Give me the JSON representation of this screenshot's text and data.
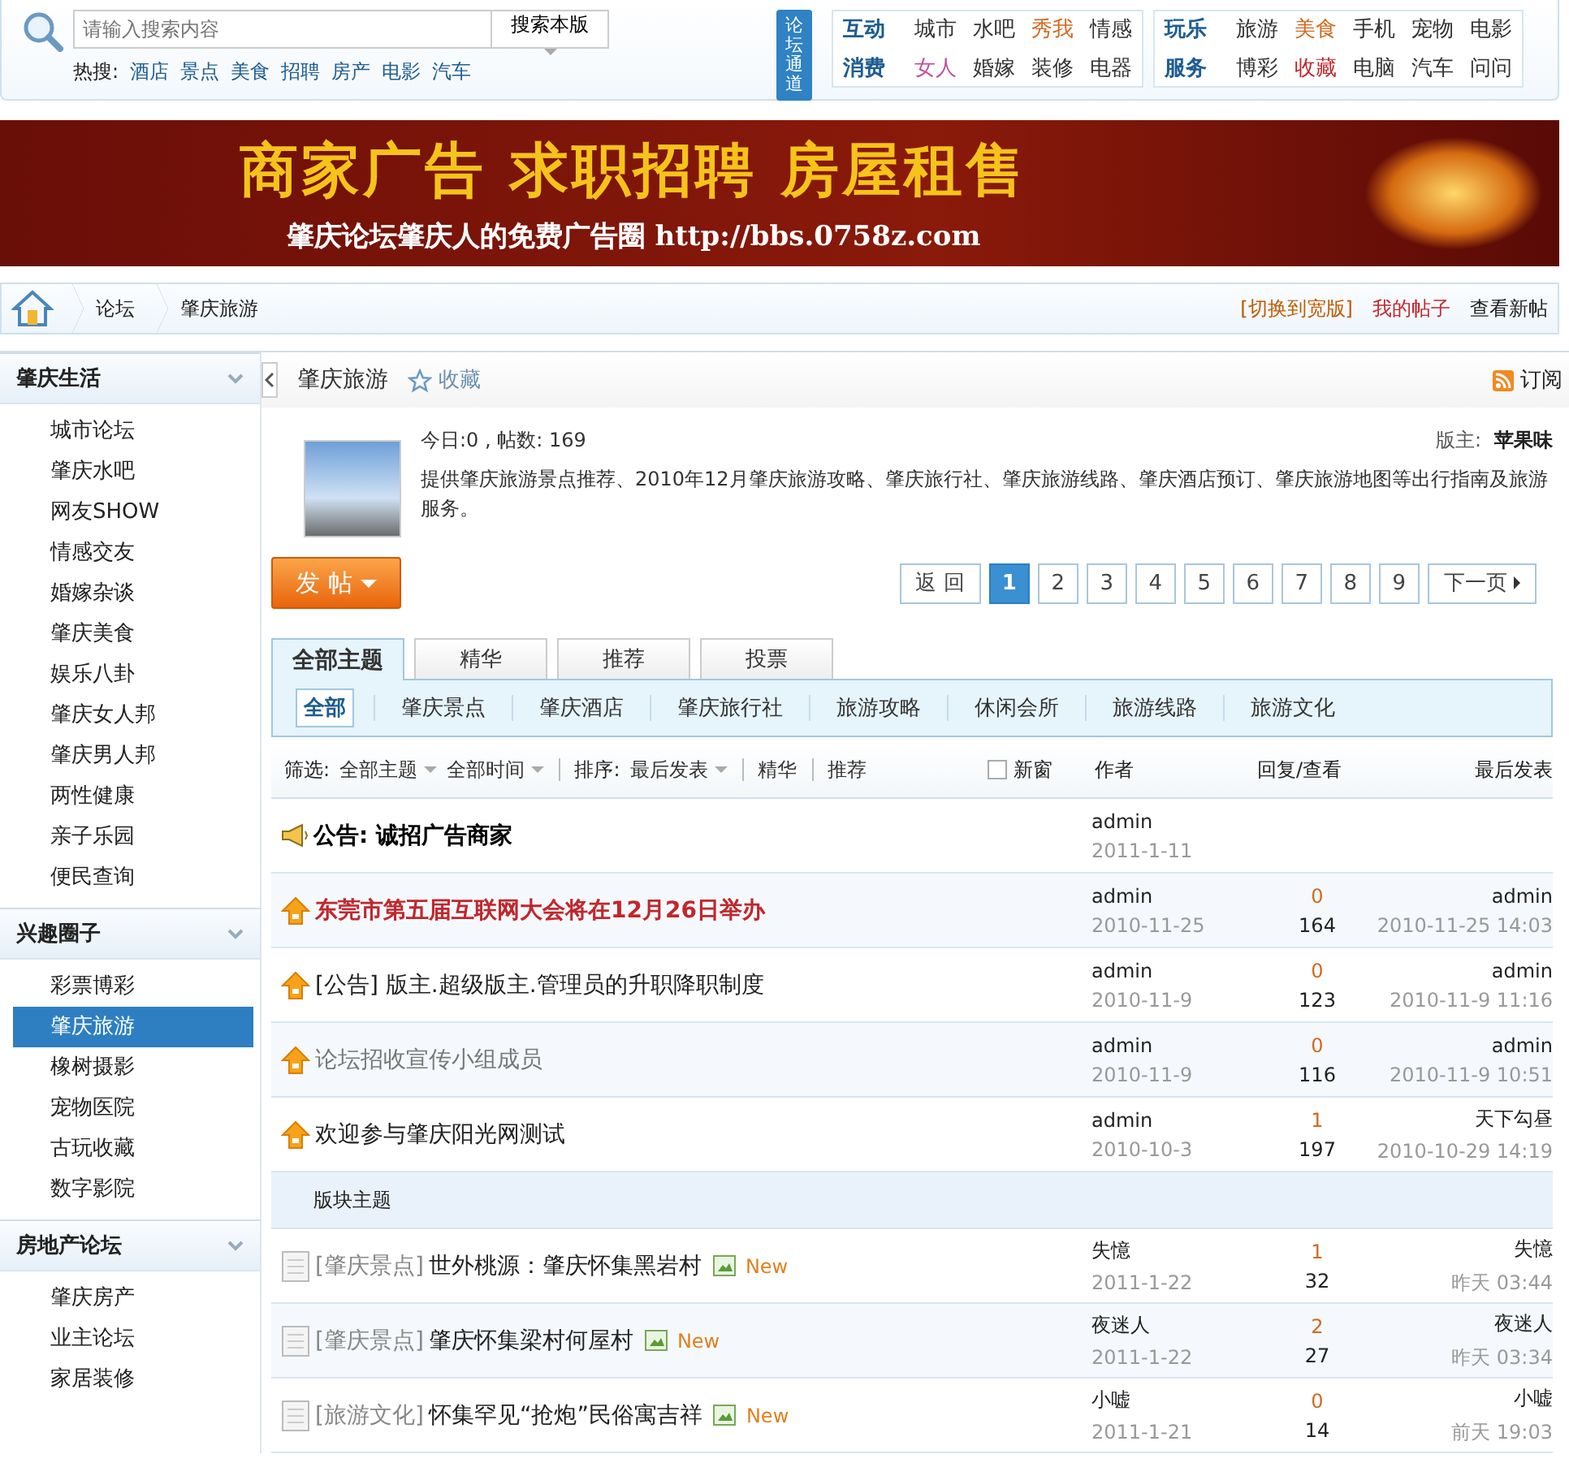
{
  "search": {
    "placeholder": "请输入搜索内容",
    "scope": "搜索本版",
    "hot_label": "热搜:",
    "hot": [
      "酒店",
      "景点",
      "美食",
      "招聘",
      "房产",
      "电影",
      "汽车"
    ]
  },
  "channel_badge": "论坛通道",
  "nav_groups": [
    {
      "labels": [
        "互动",
        "消费"
      ],
      "rows": [
        [
          {
            "text": "城市",
            "color": "#333333"
          },
          {
            "text": "水吧",
            "color": "#333333"
          },
          {
            "text": "秀我",
            "color": "#d2691e"
          },
          {
            "text": "情感",
            "color": "#333333"
          }
        ],
        [
          {
            "text": "女人",
            "color": "#c0509a"
          },
          {
            "text": "婚嫁",
            "color": "#333333"
          },
          {
            "text": "装修",
            "color": "#333333"
          },
          {
            "text": "电器",
            "color": "#333333"
          }
        ]
      ]
    },
    {
      "labels": [
        "玩乐",
        "服务"
      ],
      "rows": [
        [
          {
            "text": "旅游",
            "color": "#333333"
          },
          {
            "text": "美食",
            "color": "#d2691e"
          },
          {
            "text": "手机",
            "color": "#333333"
          },
          {
            "text": "宠物",
            "color": "#333333"
          },
          {
            "text": "电影",
            "color": "#333333"
          }
        ],
        [
          {
            "text": "博彩",
            "color": "#333333"
          },
          {
            "text": "收藏",
            "color": "#c0272d"
          },
          {
            "text": "电脑",
            "color": "#333333"
          },
          {
            "text": "汽车",
            "color": "#333333"
          },
          {
            "text": "问问",
            "color": "#333333"
          }
        ]
      ]
    }
  ],
  "banner": {
    "headline": "商家广告 求职招聘 房屋租售",
    "tagline": "肇庆论坛肇庆人的免费广告圈 http://bbs.0758z.com"
  },
  "breadcrumb": [
    "论坛",
    "肇庆旅游"
  ],
  "top_links": [
    {
      "text": "[切换到宽版]",
      "color": "#c05a00"
    },
    {
      "text": "我的帖子",
      "color": "#c0272d"
    },
    {
      "text": "查看新帖",
      "color": "#222222"
    }
  ],
  "sidebar": [
    {
      "title": "肇庆生活",
      "items": [
        {
          "label": "城市论坛",
          "selected": false
        },
        {
          "label": "肇庆水吧",
          "selected": false
        },
        {
          "label": "网友SHOW",
          "selected": false
        },
        {
          "label": "情感交友",
          "selected": false
        },
        {
          "label": "婚嫁杂谈",
          "selected": false
        },
        {
          "label": "肇庆美食",
          "selected": false
        },
        {
          "label": "娱乐八卦",
          "selected": false
        },
        {
          "label": "肇庆女人邦",
          "selected": false
        },
        {
          "label": "肇庆男人邦",
          "selected": false
        },
        {
          "label": "两性健康",
          "selected": false
        },
        {
          "label": "亲子乐园",
          "selected": false
        },
        {
          "label": "便民查询",
          "selected": false
        }
      ]
    },
    {
      "title": "兴趣圈子",
      "items": [
        {
          "label": "彩票博彩",
          "selected": false
        },
        {
          "label": "肇庆旅游",
          "selected": true
        },
        {
          "label": "橡树摄影",
          "selected": false
        },
        {
          "label": "宠物医院",
          "selected": false
        },
        {
          "label": "古玩收藏",
          "selected": false
        },
        {
          "label": "数字影院",
          "selected": false
        }
      ]
    },
    {
      "title": "房地产论坛",
      "items": [
        {
          "label": "肇庆房产",
          "selected": false
        },
        {
          "label": "业主论坛",
          "selected": false
        },
        {
          "label": "家居装修",
          "selected": false
        }
      ]
    }
  ],
  "forum": {
    "title": "肇庆旅游",
    "favorite": "收藏",
    "subscribe": "订阅",
    "stats": "今日:0 , 帖数: 169",
    "moderator_label": "版主:",
    "moderator": "苹果味",
    "description": "提供肇庆旅游景点推荐、2010年12月肇庆旅游攻略、肇庆旅行社、肇庆旅游线路、肇庆酒店预订、肇庆旅游地图等出行指南及旅游服务。"
  },
  "post_button": "发 帖",
  "pagination": {
    "back": "返 回",
    "pages": [
      {
        "label": "1",
        "selected": true
      },
      {
        "label": "2",
        "selected": false
      },
      {
        "label": "3",
        "selected": false
      },
      {
        "label": "4",
        "selected": false
      },
      {
        "label": "5",
        "selected": false
      },
      {
        "label": "6",
        "selected": false
      },
      {
        "label": "7",
        "selected": false
      },
      {
        "label": "8",
        "selected": false
      },
      {
        "label": "9",
        "selected": false
      }
    ],
    "next": "下一页"
  },
  "tabs": [
    {
      "label": "全部主题",
      "selected": true
    },
    {
      "label": "精华",
      "selected": false
    },
    {
      "label": "推荐",
      "selected": false
    },
    {
      "label": "投票",
      "selected": false
    }
  ],
  "categories": [
    {
      "label": "全部",
      "selected": true
    },
    {
      "label": "肇庆景点",
      "selected": false
    },
    {
      "label": "肇庆酒店",
      "selected": false
    },
    {
      "label": "肇庆旅行社",
      "selected": false
    },
    {
      "label": "旅游攻略",
      "selected": false
    },
    {
      "label": "休闲会所",
      "selected": false
    },
    {
      "label": "旅游线路",
      "selected": false
    },
    {
      "label": "旅游文化",
      "selected": false
    }
  ],
  "filter_bar": {
    "filter_label": "筛选:",
    "type_filter": "全部主题",
    "time_filter": "全部时间",
    "sort_label": "排序:",
    "sort": "最后发表",
    "digest": "精华",
    "recommend": "推荐",
    "new_window": {
      "label": "新窗",
      "checked": false
    },
    "columns": [
      "作者",
      "回复/查看",
      "最后发表"
    ]
  },
  "pinned_threads": [
    {
      "kind": "announcement",
      "title": "公告: 诚招广告商家",
      "color": "#000000",
      "bold": true,
      "author": "admin",
      "date": "2011-1-11"
    },
    {
      "kind": "sticky",
      "title": "东莞市第五届互联网大会将在12月26日举办",
      "color": "#c0272d",
      "bold": true,
      "author": "admin",
      "date": "2010-11-25",
      "replies": "0",
      "views": "164",
      "last_poster": "admin",
      "last_time": "2010-11-25 14:03"
    },
    {
      "kind": "sticky",
      "title": "[公告] 版主.超级版主.管理员的升职降职制度",
      "color": "#222222",
      "bold": false,
      "author": "admin",
      "date": "2010-11-9",
      "replies": "0",
      "views": "123",
      "last_poster": "admin",
      "last_time": "2010-11-9 11:16"
    },
    {
      "kind": "sticky",
      "title": "论坛招收宣传小组成员",
      "color": "#777777",
      "bold": false,
      "author": "admin",
      "date": "2010-11-9",
      "replies": "0",
      "views": "116",
      "last_poster": "admin",
      "last_time": "2010-11-9 10:51"
    },
    {
      "kind": "sticky",
      "title": "欢迎参与肇庆阳光网测试",
      "color": "#222222",
      "bold": false,
      "author": "admin",
      "date": "2010-10-3",
      "replies": "1",
      "views": "197",
      "last_poster": "天下勾昼",
      "last_time": "2010-10-29 14:19"
    }
  ],
  "section_label": "版块主题",
  "threads": [
    {
      "kind": "normal",
      "category": "[肇庆景点]",
      "title": "世外桃源：肇庆怀集黑岩村",
      "color": "#222222",
      "bold": false,
      "new_label": "New",
      "author": "失憶",
      "date": "2011-1-22",
      "replies": "1",
      "views": "32",
      "last_poster": "失憶",
      "last_time": "昨天 03:44"
    },
    {
      "kind": "normal",
      "category": "[肇庆景点]",
      "title": "肇庆怀集梁村何屋村",
      "color": "#222222",
      "bold": false,
      "new_label": "New",
      "author": "夜迷人",
      "date": "2011-1-22",
      "replies": "2",
      "views": "27",
      "last_poster": "夜迷人",
      "last_time": "昨天 03:34"
    },
    {
      "kind": "normal",
      "category": "[旅游文化]",
      "title": "怀集罕见“抢炮”民俗寓吉祥",
      "color": "#222222",
      "bold": false,
      "new_label": "New",
      "author": "小嘘",
      "date": "2011-1-21",
      "replies": "0",
      "views": "14",
      "last_poster": "小嘘",
      "last_time": "前天 19:03"
    }
  ]
}
